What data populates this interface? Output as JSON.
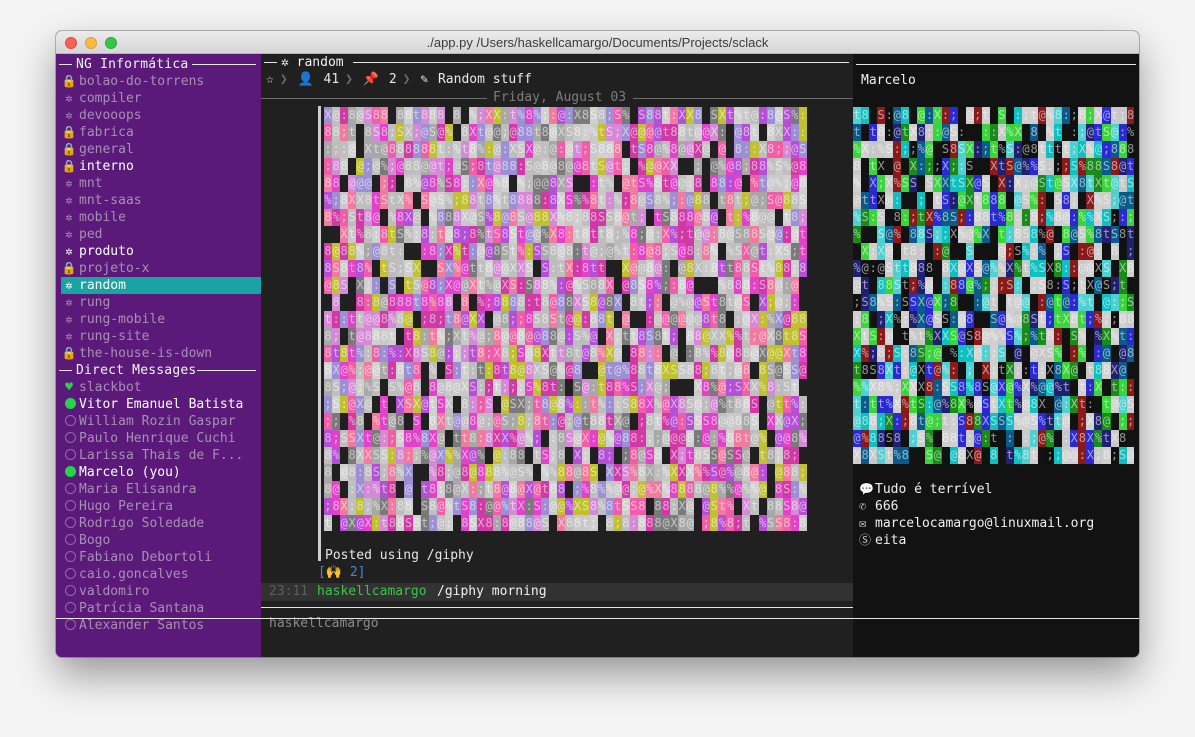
{
  "window": {
    "title": "./app.py  /Users/haskellcamargo/Documents/Projects/sclack"
  },
  "sidebar": {
    "team_name": "NG Informática",
    "channels": [
      {
        "name": "bolao-do-torrens",
        "icon": "lock",
        "state": "dim"
      },
      {
        "name": "compiler",
        "icon": "gear",
        "state": "dim"
      },
      {
        "name": "devooops",
        "icon": "gear",
        "state": "dim"
      },
      {
        "name": "fabrica",
        "icon": "lock",
        "state": "dim"
      },
      {
        "name": "general",
        "icon": "lock",
        "state": "dim"
      },
      {
        "name": "interno",
        "icon": "lock",
        "state": "bright"
      },
      {
        "name": "mnt",
        "icon": "gear",
        "state": "dim"
      },
      {
        "name": "mnt-saas",
        "icon": "gear",
        "state": "dim"
      },
      {
        "name": "mobile",
        "icon": "gear",
        "state": "dim"
      },
      {
        "name": "ped",
        "icon": "gear",
        "state": "dim"
      },
      {
        "name": "produto",
        "icon": "gear",
        "state": "bright"
      },
      {
        "name": "projeto-x",
        "icon": "lock",
        "state": "dim"
      },
      {
        "name": "random",
        "icon": "gear",
        "state": "active"
      },
      {
        "name": "rung",
        "icon": "gear",
        "state": "dim"
      },
      {
        "name": "rung-mobile",
        "icon": "gear",
        "state": "dim"
      },
      {
        "name": "rung-site",
        "icon": "gear",
        "state": "dim"
      },
      {
        "name": "the-house-is-down",
        "icon": "lock",
        "state": "dim"
      }
    ],
    "dm_heading": "Direct Messages",
    "dms": [
      {
        "name": "slackbot",
        "status": "heart",
        "state": "dim"
      },
      {
        "name": "Vitor Emanuel Batista",
        "status": "online",
        "state": "bright"
      },
      {
        "name": "William Rozin Gaspar",
        "status": "offline",
        "state": "dim"
      },
      {
        "name": "Paulo Henrique Cuchi",
        "status": "offline",
        "state": "dim"
      },
      {
        "name": "Larissa Thais de F...",
        "status": "offline",
        "state": "dim"
      },
      {
        "name": "Marcelo (you)",
        "status": "online",
        "state": "bright"
      },
      {
        "name": "Maria Elisandra",
        "status": "offline",
        "state": "dim"
      },
      {
        "name": "Hugo Pereira",
        "status": "offline",
        "state": "dim"
      },
      {
        "name": "Rodrigo Soledade",
        "status": "offline",
        "state": "dim"
      },
      {
        "name": "Bogo",
        "status": "offline",
        "state": "dim"
      },
      {
        "name": "Fabiano Debortoli",
        "status": "offline",
        "state": "dim"
      },
      {
        "name": "caio.goncalves",
        "status": "offline",
        "state": "dim"
      },
      {
        "name": "valdomiro",
        "status": "offline",
        "state": "dim"
      },
      {
        "name": "Patrícia Santana",
        "status": "offline",
        "state": "dim"
      },
      {
        "name": "Alexander Santos",
        "status": "offline",
        "state": "dim"
      }
    ]
  },
  "channel": {
    "name": "random",
    "members": "41",
    "pins": "2",
    "topic": "Random stuff",
    "date_divider": "Friday, August 03"
  },
  "messages": {
    "giphy_caption": "Posted using /giphy",
    "reaction_emoji": "🙌",
    "reaction_count": "2",
    "last_time": "23:11",
    "last_user": "haskellcamargo",
    "last_text": "/giphy morning"
  },
  "input": {
    "placeholder": "haskellcamargo"
  },
  "profile": {
    "name": "Marcelo",
    "status": "Tudo é terrível",
    "phone": "666",
    "email": "marcelocamargo@linuxmail.org",
    "skype": "eita"
  },
  "colors": {
    "sidebar_bg": "#5b1a7a",
    "active_channel": "#1ba3a3",
    "online": "#25d34a",
    "username": "#3dc44a"
  }
}
